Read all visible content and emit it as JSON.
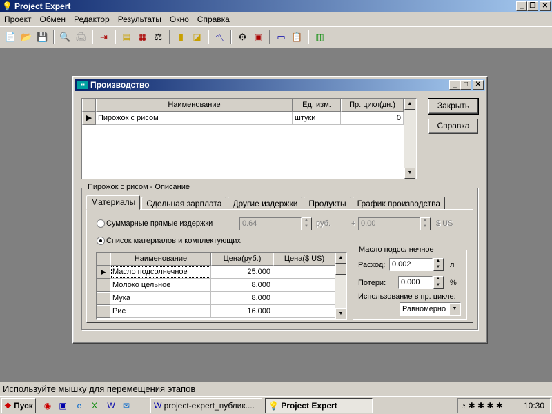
{
  "app": {
    "title": "Project Expert"
  },
  "menu": [
    {
      "label": "Проект"
    },
    {
      "label": "Обмен"
    },
    {
      "label": "Редактор"
    },
    {
      "label": "Результаты"
    },
    {
      "label": "Окно"
    },
    {
      "label": "Справка"
    }
  ],
  "toolbar_icons": [
    "new-icon",
    "open-icon",
    "save-icon",
    "preview-icon",
    "print-icon",
    "exit-icon",
    "notes-icon",
    "cashflow-icon",
    "balance-icon",
    "chart-icon",
    "pointer-chart-icon",
    "line-chart-icon",
    "analysis-icon",
    "report-icon",
    "window-icon",
    "clipboard-icon",
    "calculator-icon"
  ],
  "dialog": {
    "title": "Производство",
    "grid": {
      "headers": [
        "Наименование",
        "Ед. изм.",
        "Пр. цикл(дн.)"
      ],
      "rows": [
        {
          "name": "Пирожок с рисом",
          "unit": "штуки",
          "cycle": "0"
        }
      ]
    },
    "buttons": {
      "close": "Закрыть",
      "help": "Справка"
    },
    "desc_group_label": "Пирожок с рисом - Описание",
    "tabs": [
      "Материалы",
      "Сдельная зарплата",
      "Другие издержки",
      "Продукты",
      "График производства"
    ],
    "materials": {
      "radio_total": "Суммарные прямые издержки",
      "radio_list": "Список материалов и комплектующих",
      "total_rub": "0.64",
      "rub_label": "руб.",
      "plus": "+",
      "total_usd": "0.00",
      "usd_label": "$ US",
      "grid": {
        "headers": [
          "Наименование",
          "Цена(руб.)",
          "Цена($ US)"
        ],
        "rows": [
          {
            "name": "Масло подсолнечное",
            "price_rub": "25.000",
            "price_usd": ""
          },
          {
            "name": "Молоко цельное",
            "price_rub": "8.000",
            "price_usd": ""
          },
          {
            "name": "Мука",
            "price_rub": "8.000",
            "price_usd": ""
          },
          {
            "name": "Рис",
            "price_rub": "16.000",
            "price_usd": ""
          }
        ]
      },
      "detail": {
        "group_label": "Масло подсолнечное",
        "consumption_label": "Расход:",
        "consumption_value": "0.002",
        "consumption_unit": "л",
        "loss_label": "Потери:",
        "loss_value": "0.000",
        "loss_unit": "%",
        "usage_label": "Использование в пр. цикле:",
        "usage_value": "Равномерно"
      }
    }
  },
  "status": "Используйте мышку для перемещения этапов",
  "taskbar": {
    "start": "Пуск",
    "tasks": [
      {
        "label": "project-expert_публик...."
      },
      {
        "label": "Project Expert"
      }
    ],
    "clock": "10:30"
  }
}
